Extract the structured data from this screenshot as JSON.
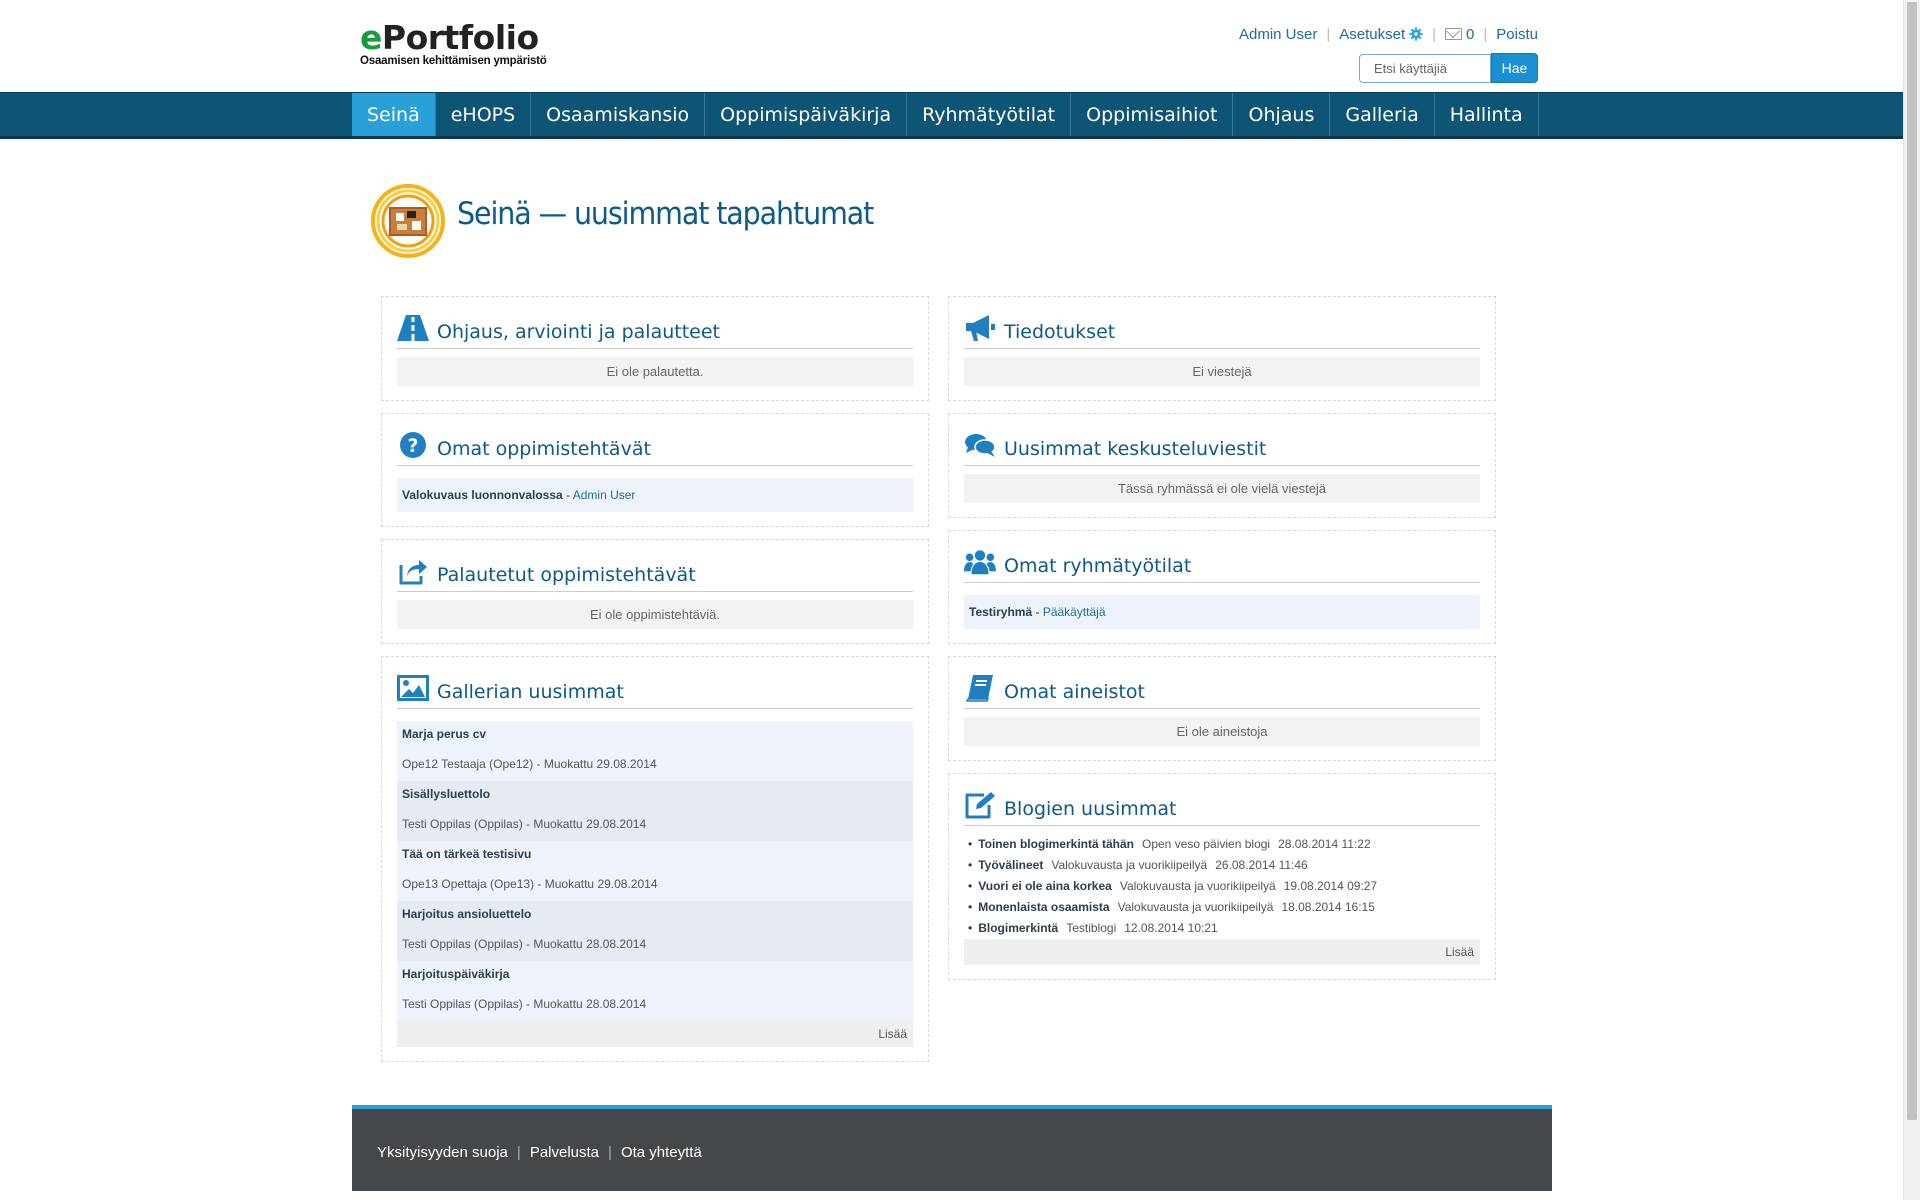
{
  "logo": {
    "brand_prefix": "e",
    "brand_rest": "Portfolio",
    "subtitle": "Osaamisen kehittämisen ympäristö"
  },
  "toplinks": {
    "user": "Admin User",
    "settings": "Asetukset",
    "messages_count": "0",
    "logout": "Poistu"
  },
  "search": {
    "placeholder": "Etsi käyttäjiä",
    "button": "Hae"
  },
  "nav": [
    {
      "label": "Seinä",
      "active": true
    },
    {
      "label": "eHOPS"
    },
    {
      "label": "Osaamiskansio"
    },
    {
      "label": "Oppimispäiväkirja"
    },
    {
      "label": "Ryhmätyötilat"
    },
    {
      "label": "Oppimisaihiot"
    },
    {
      "label": "Ohjaus"
    },
    {
      "label": "Galleria"
    },
    {
      "label": "Hallinta"
    }
  ],
  "page": {
    "title": "Seinä — uusimmat tapahtumat"
  },
  "panels": {
    "ohjaus": {
      "title": "Ohjaus, arviointi ja palautteet",
      "empty": "Ei ole palautetta."
    },
    "tehtavat": {
      "title": "Omat oppimistehtävät",
      "item_title": "Valokuvaus luonnonvalossa",
      "item_author": "Admin User"
    },
    "palautetut": {
      "title": "Palautetut oppimistehtävät",
      "empty": "Ei ole oppimistehtäviä."
    },
    "galleria": {
      "title": "Gallerian uusimmat",
      "items": [
        {
          "title": "Marja perus cv",
          "meta": "Ope12 Testaaja (Ope12) - Muokattu 29.08.2014"
        },
        {
          "title": "Sisällysluettolo",
          "meta": "Testi Oppilas (Oppilas) - Muokattu 29.08.2014"
        },
        {
          "title": "Tää on tärkeä testisivu",
          "meta": "Ope13 Opettaja (Ope13) - Muokattu 29.08.2014"
        },
        {
          "title": "Harjoitus ansioluettelo",
          "meta": "Testi Oppilas (Oppilas) - Muokattu 28.08.2014"
        },
        {
          "title": "Harjoituspäiväkirja",
          "meta": "Testi Oppilas (Oppilas) - Muokattu 28.08.2014"
        }
      ],
      "more": "Lisää"
    },
    "tiedotukset": {
      "title": "Tiedotukset",
      "empty": "Ei viestejä"
    },
    "keskustelu": {
      "title": "Uusimmat keskusteluviestit",
      "empty": "Tässä ryhmässä ei ole vielä viestejä"
    },
    "ryhmat": {
      "title": "Omat ryhmätyötilat",
      "item_title": "Testiryhmä",
      "item_role": "Pääkäyttäjä"
    },
    "aineistot": {
      "title": "Omat aineistot",
      "empty": "Ei ole aineistoja"
    },
    "blogit": {
      "title": "Blogien uusimmat",
      "items": [
        {
          "title": "Toinen blogimerkintä tähän",
          "blog": "Open veso päivien blogi",
          "date": "28.08.2014 11:22"
        },
        {
          "title": "Työvälineet",
          "blog": "Valokuvausta ja vuorikiipeilyä",
          "date": "26.08.2014 11:46"
        },
        {
          "title": "Vuori ei ole aina korkea",
          "blog": "Valokuvausta ja vuorikiipeilyä",
          "date": "19.08.2014 09:27"
        },
        {
          "title": "Monenlaista osaamista",
          "blog": "Valokuvausta ja vuorikiipeilyä",
          "date": "18.08.2014 16:15"
        },
        {
          "title": "Blogimerkintä",
          "blog": "Testiblogi",
          "date": "12.08.2014 10:21"
        }
      ],
      "more": "Lisää"
    }
  },
  "footer": {
    "privacy": "Yksityisyyden suoja",
    "service": "Palvelusta",
    "contact": "Ota yhteyttä"
  },
  "colors": {
    "nav_bg": "#0e5474",
    "nav_active": "#2aa0d8",
    "title_blue": "#0d5a86",
    "brand_green": "#1a9a3f",
    "footer_bg": "#45484b"
  },
  "icons": [
    "settings-gear-icon",
    "mail-icon",
    "wall-board-icon",
    "road-icon",
    "question-icon",
    "share-icon",
    "image-icon",
    "megaphone-icon",
    "comments-icon",
    "group-icon",
    "book-icon",
    "edit-icon"
  ]
}
